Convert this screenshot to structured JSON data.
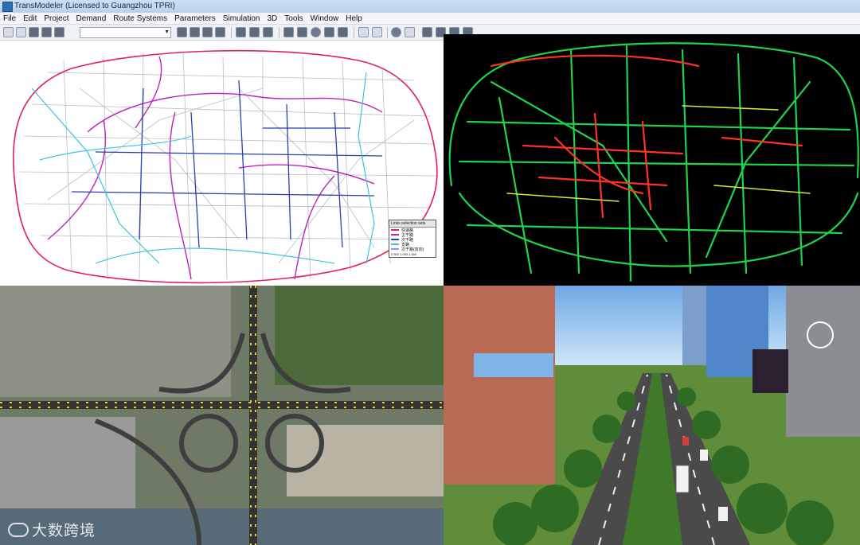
{
  "window": {
    "title": "TransModeler (Licensed to Guangzhou TPRI)"
  },
  "menu": [
    "File",
    "Edit",
    "Project",
    "Demand",
    "Route Systems",
    "Parameters",
    "Simulation",
    "3D",
    "Tools",
    "Window",
    "Help"
  ],
  "toolbar": {
    "icons": [
      "new-icon",
      "open-icon",
      "save-icon",
      "print-icon",
      "preview-icon",
      "layer-icon",
      "table-icon",
      "cut-icon",
      "align-icon",
      "grid-icon",
      "select-icon",
      "node-icon",
      "link-icon",
      "lane-icon",
      "signal-icon",
      "turn-icon",
      "detector-icon",
      "sensor-icon",
      "undo-icon",
      "redo-icon",
      "record-icon",
      "pencil-icon",
      "stop-icon",
      "pause-icon",
      "zoom-icon"
    ],
    "combo_value": ""
  },
  "legend": {
    "title": "Links selection sets",
    "entries": [
      {
        "label": "快速路",
        "color": "#e0205a"
      },
      {
        "label": "主干路",
        "color": "#c020c0"
      },
      {
        "label": "次干路",
        "color": "#3040c0"
      },
      {
        "label": "支路",
        "color": "#30c0e0"
      },
      {
        "label": "次干路(双向)",
        "color": "#9090ff"
      }
    ],
    "scale": "0   500  1,000 1,500"
  },
  "panels": [
    {
      "name": "network-map",
      "content": "road-network-map"
    },
    {
      "name": "traffic-flow",
      "content": "traffic-speed-map"
    },
    {
      "name": "satellite-view",
      "content": "interchange-satellite"
    },
    {
      "name": "3d-view",
      "content": "3d-street-scene"
    }
  ],
  "watermark": {
    "text": "大数跨境"
  },
  "colors": {
    "titlebar": "#cfe0f3",
    "map_bg": "#ffffff",
    "flow_bg": "#000000",
    "flow_fast": "#22e04a",
    "flow_slow": "#ff3322",
    "expressway": "#e0205a",
    "arterial": "#c020c0",
    "sky": "#9cc7ef"
  }
}
